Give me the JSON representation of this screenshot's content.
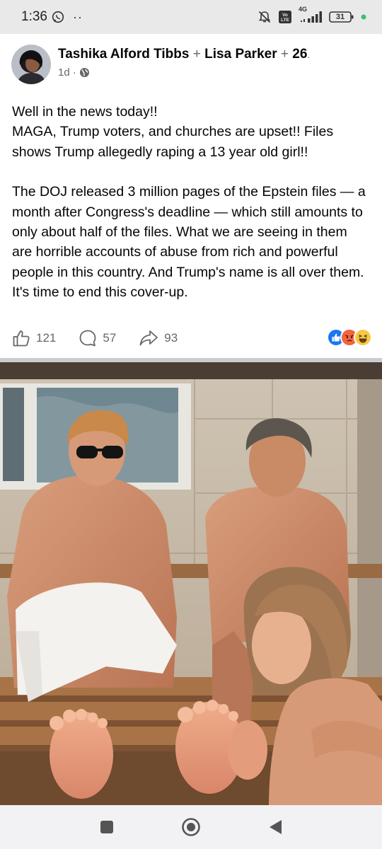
{
  "status_bar": {
    "time": "1:36",
    "dots": "··",
    "network": "4G",
    "battery": "31",
    "icons": [
      "whatsapp-icon",
      "alarm-off-icon",
      "volte-icon",
      "signal-icon",
      "battery-icon",
      "notification-dot-icon"
    ]
  },
  "post": {
    "authors": [
      "Tashika Alford Tibbs",
      "Lisa Parker"
    ],
    "separator": "+",
    "others_count": "26",
    "time_ago": "1d",
    "meta_separator": "·",
    "privacy_icon": "globe-icon",
    "text": {
      "p1_line1": "Well in the news today!!",
      "p1_line2": "MAGA, Trump voters, and churches are upset!! Files shows Trump allegedly raping a 13 year old girl!!",
      "p2": "The DOJ released 3 million pages of the Epstein files — a month after Congress's deadline — which still amounts to only about half of the files. What we are seeing in them are horrible accounts of abuse from rich and powerful people in this country. And Trump's name is all over them. It's time to end this cover-up."
    }
  },
  "engagement": {
    "likes": "121",
    "comments": "57",
    "shares": "93",
    "reactions": [
      "like-reaction-icon",
      "angry-reaction-icon",
      "haha-reaction-icon"
    ]
  },
  "nav": {
    "icons": [
      "recents-icon",
      "home-icon",
      "back-icon"
    ]
  },
  "colors": {
    "status_bg": "#e9e9ea",
    "text": "#050505",
    "secondary": "#65676b",
    "like_blue": "#1877f2",
    "divider": "#c9ccd1",
    "nav_bg": "#f2f2f4"
  }
}
